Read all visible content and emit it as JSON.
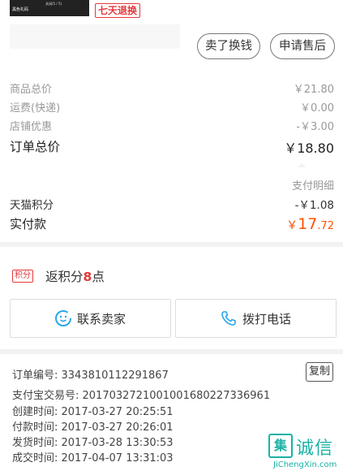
{
  "top": {
    "thumb_text_1": "黑色礼码",
    "thumb_text_2": "关闭(5 / 5)",
    "return_badge": "七天退换",
    "sell_button": "卖了换钱",
    "after_sale_button": "申请售后"
  },
  "prices": {
    "goods_total_label": "商品总价",
    "goods_total_value": "￥21.80",
    "shipping_label": "运费(快递)",
    "shipping_value": "￥0.00",
    "discount_label": "店铺优惠",
    "discount_value": "-￥3.00",
    "order_total_label": "订单总价",
    "order_total_value": "￥18.80"
  },
  "payment": {
    "detail_link": "支付明细",
    "tmall_points_label": "天猫积分",
    "tmall_points_value": "-￥1.08",
    "paid_label": "实付款",
    "paid_currency": "￥",
    "paid_int": "17",
    "paid_dec": ".72"
  },
  "points": {
    "badge": "积分",
    "text_prefix": "返积分",
    "amount": "8",
    "text_suffix": "点"
  },
  "actions": {
    "contact_label": "联系卖家",
    "call_label": "拨打电话"
  },
  "order_info": {
    "order_no": "订单编号:  3343810112291867",
    "copy_label": "复制",
    "alipay_no": "支付宝交易号:  2017032721001001680227336961",
    "created": "创建时间:  2017-03-27  20:25:51",
    "paid_time": "付款时间:  2017-03-27  20:26:01",
    "shipped": "发货时间:  2017-03-28  13:30:53",
    "completed": "成交时间:  2017-04-07  13:31:03"
  },
  "watermark": {
    "logo": "集",
    "chinese": "诚信",
    "url": "JiChengXin.com"
  },
  "colors": {
    "accent_red": "#e4393c",
    "price_orange": "#ff5000",
    "watermark_teal": "#19b2a5"
  }
}
